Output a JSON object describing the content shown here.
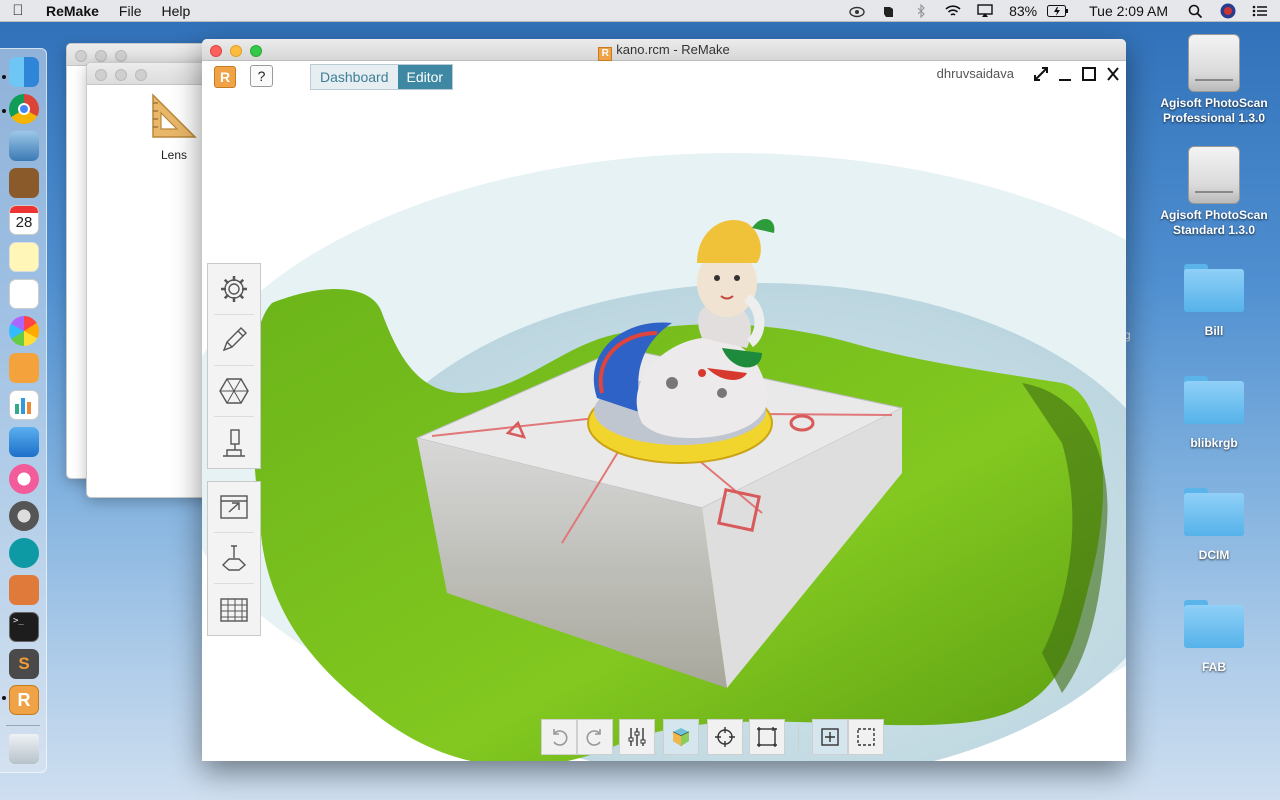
{
  "menubar": {
    "app_name": "ReMake",
    "items": [
      "File",
      "Help"
    ],
    "battery": "83%",
    "clock": "Tue 2:09 AM"
  },
  "dock": {
    "icons": [
      "finder-icon",
      "chrome-icon",
      "preview-icon",
      "contacts-icon",
      "calendar-icon",
      "notes-icon",
      "reminders-icon",
      "photos-icon",
      "pages-icon",
      "numbers-icon",
      "keynote-icon",
      "itunes-icon",
      "system-preferences-icon",
      "arduino-icon",
      "app-store-icon",
      "terminal-icon",
      "sublime-icon",
      "remake-icon",
      "trash-icon"
    ],
    "calendar_day": "28"
  },
  "desktop": {
    "items": [
      {
        "label": "Agisoft PhotoScan Professional 1.3.0",
        "kind": "drive"
      },
      {
        "label": "Agisoft PhotoScan Standard 1.3.0",
        "kind": "drive"
      },
      {
        "label": "Bill",
        "kind": "folder"
      },
      {
        "label": "blibkrgb",
        "kind": "folder"
      },
      {
        "label": "DCIM",
        "kind": "folder"
      },
      {
        "label": "FAB",
        "kind": "folder"
      }
    ],
    "partial_text": "g"
  },
  "finder_back": {
    "item_label": "Lens"
  },
  "window": {
    "title": "kano.rcm - ReMake",
    "logo_letter": "R",
    "help_label": "?",
    "tabs": [
      {
        "label": "Dashboard",
        "active": false
      },
      {
        "label": "Editor",
        "active": true
      }
    ],
    "user": "dhruvsaidava"
  },
  "left_tools_top": [
    "settings-icon",
    "pencil-icon",
    "mesh-icon",
    "analyze-icon"
  ],
  "left_tools_bottom": [
    "export-icon",
    "print-icon",
    "grid-icon"
  ],
  "bottom_tools": [
    "undo-icon",
    "redo-icon",
    "sliders-icon",
    "shading-cube-icon",
    "target-icon",
    "frame-icon",
    "select-box-icon",
    "deselect-box-icon"
  ],
  "colors": {
    "accent": "#3f88a3",
    "ground_green": "#7cc11e",
    "brand_orange": "#f0a346"
  }
}
